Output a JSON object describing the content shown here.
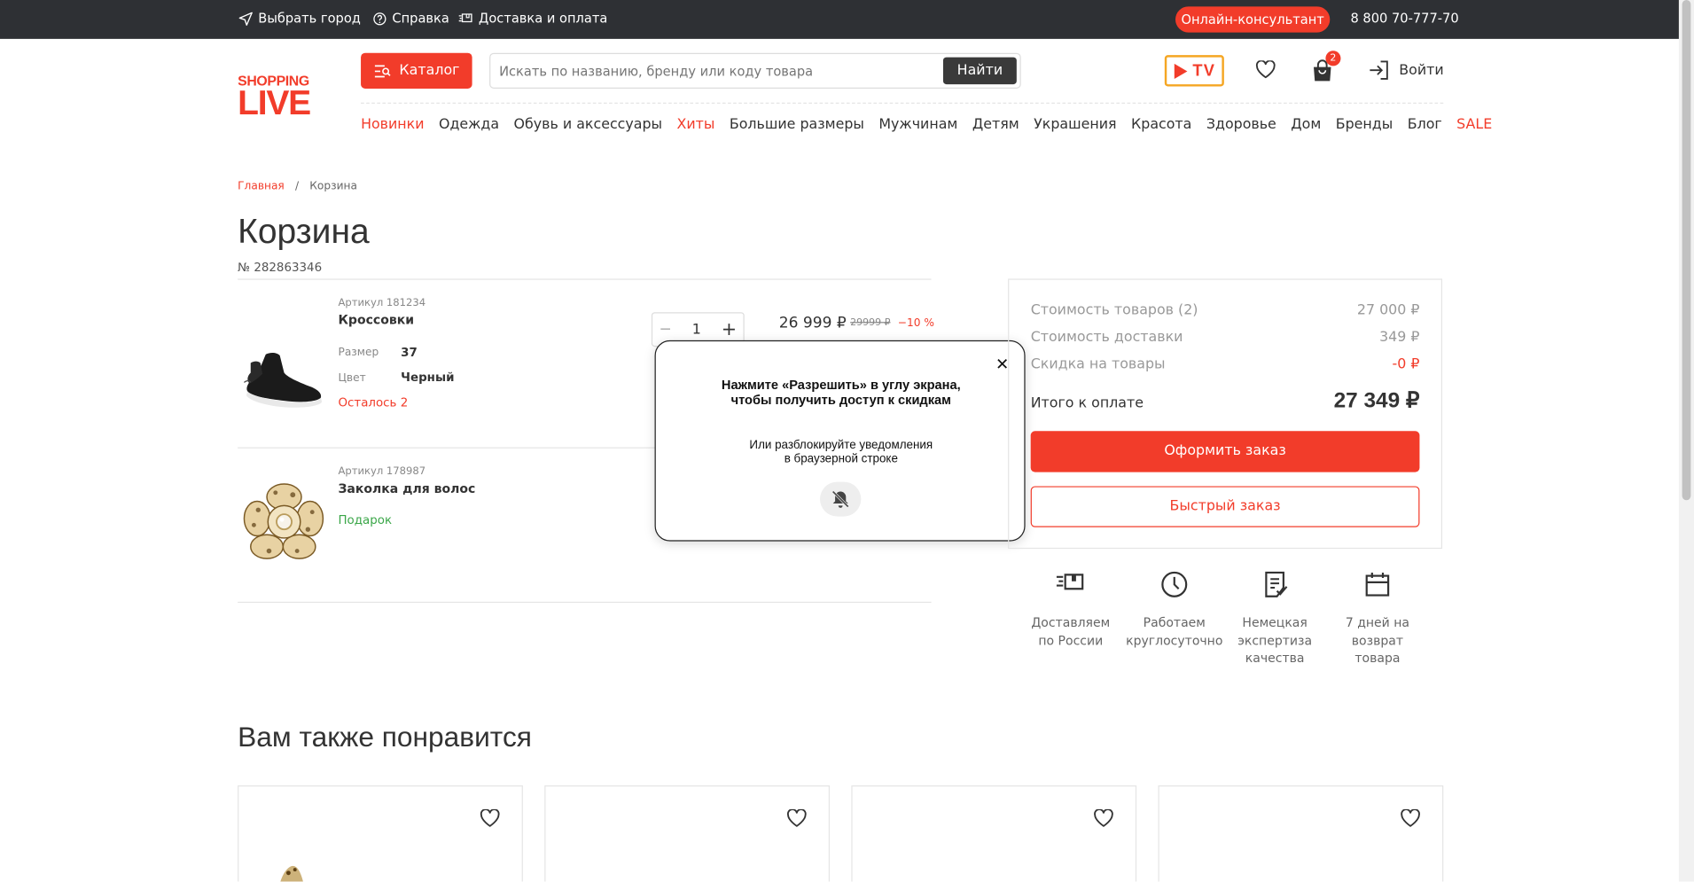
{
  "topbar": {
    "city": "Выбрать город",
    "help": "Справка",
    "delivery": "Доставка и оплата",
    "consultant": "Онлайн-консультант",
    "phone": "8 800 70-777-70"
  },
  "header": {
    "logo_line1": "SHOPPING",
    "logo_line2": "LIVE",
    "catalog": "Каталог",
    "search_placeholder": "Искать по названию, бренду или коду товара",
    "search_button": "Найти",
    "tv_label": "TV",
    "cart_count": "2",
    "login": "Войти"
  },
  "nav": [
    {
      "label": "Новинки",
      "accent": true
    },
    {
      "label": "Одежда",
      "accent": false
    },
    {
      "label": "Обувь и аксессуары",
      "accent": false
    },
    {
      "label": "Хиты",
      "accent": true
    },
    {
      "label": "Большие размеры",
      "accent": false
    },
    {
      "label": "Мужчинам",
      "accent": false
    },
    {
      "label": "Детям",
      "accent": false
    },
    {
      "label": "Украшения",
      "accent": false
    },
    {
      "label": "Красота",
      "accent": false
    },
    {
      "label": "Здоровье",
      "accent": false
    },
    {
      "label": "Дом",
      "accent": false
    },
    {
      "label": "Бренды",
      "accent": false
    },
    {
      "label": "Блог",
      "accent": false
    },
    {
      "label": "SALE",
      "accent": true
    }
  ],
  "breadcrumb": {
    "home": "Главная",
    "sep": "/",
    "current": "Корзина"
  },
  "page": {
    "title": "Корзина",
    "order_number": "№ 282863346"
  },
  "items": [
    {
      "article": "Артикул 181234",
      "name": "Кроссовки",
      "size_label": "Размер",
      "size_value": "37",
      "color_label": "Цвет",
      "color_value": "Черный",
      "stock": "Осталось 2",
      "qty": "1",
      "price": "26 999 ₽",
      "old_price": "29999 ₽",
      "discount": "−10 %"
    },
    {
      "article": "Артикул 178987",
      "name": "Заколка для волос",
      "gift": "Подарок"
    }
  ],
  "popup": {
    "title_line1": "Нажмите «Разрешить» в углу экрана,",
    "title_line2": "чтобы получить доступ к скидкам",
    "sub_line1": "Или разблокируйте уведомления",
    "sub_line2": "в браузерной строке",
    "close": "✕"
  },
  "summary": {
    "goods_label": "Стоимость товаров (2)",
    "goods_value": "27 000 ₽",
    "delivery_label": "Стоимость доставки",
    "delivery_value": "349 ₽",
    "discount_label": "Скидка на товары",
    "discount_value": "-0 ₽",
    "total_label": "Итого к оплате",
    "total_value": "27 349 ₽",
    "order_button": "Оформить заказ",
    "fast_button": "Быстрый заказ"
  },
  "features": [
    {
      "line1": "Доставляем",
      "line2": "по России",
      "line3": ""
    },
    {
      "line1": "Работаем",
      "line2": "круглосуточно",
      "line3": ""
    },
    {
      "line1": "Немецкая",
      "line2": "экспертиза",
      "line3": "качества"
    },
    {
      "line1": "7 дней на",
      "line2": "возврат",
      "line3": "товара"
    }
  ],
  "recommend": {
    "title": "Вам также понравится"
  },
  "colors": {
    "accent": "#f23c2a",
    "topbar": "#2e3034",
    "gift": "#3aa648"
  }
}
